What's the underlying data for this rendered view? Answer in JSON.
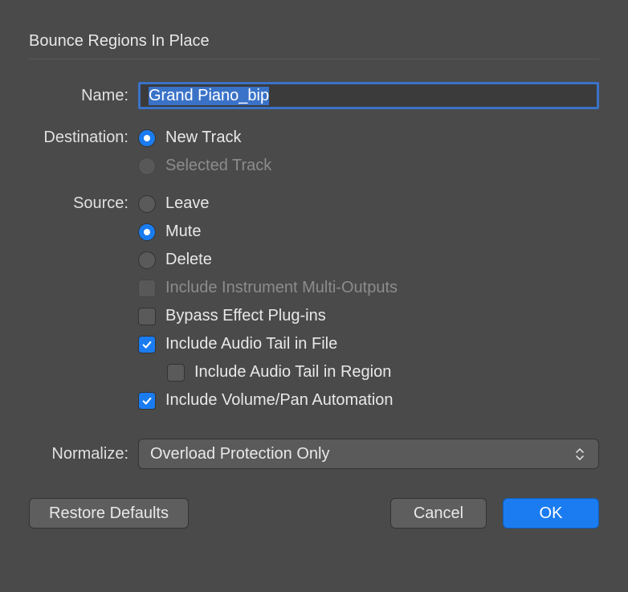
{
  "dialog": {
    "title": "Bounce Regions In Place"
  },
  "name": {
    "label": "Name:",
    "value": "Grand Piano_bip"
  },
  "destination": {
    "label": "Destination:",
    "options": {
      "new_track": "New Track",
      "selected_track": "Selected Track"
    },
    "selected": "new_track"
  },
  "source": {
    "label": "Source:",
    "options": {
      "leave": "Leave",
      "mute": "Mute",
      "delete": "Delete"
    },
    "selected": "mute",
    "checkboxes": {
      "include_multi_outputs": {
        "label": "Include Instrument Multi-Outputs",
        "checked": false,
        "disabled": true
      },
      "bypass_effects": {
        "label": "Bypass Effect Plug-ins",
        "checked": false,
        "disabled": false
      },
      "include_tail_file": {
        "label": "Include Audio Tail in File",
        "checked": true,
        "disabled": false
      },
      "include_tail_region": {
        "label": "Include Audio Tail in Region",
        "checked": false,
        "disabled": false
      },
      "include_vol_pan": {
        "label": "Include Volume/Pan Automation",
        "checked": true,
        "disabled": false
      }
    }
  },
  "normalize": {
    "label": "Normalize:",
    "value": "Overload Protection Only"
  },
  "buttons": {
    "restore": "Restore Defaults",
    "cancel": "Cancel",
    "ok": "OK"
  }
}
